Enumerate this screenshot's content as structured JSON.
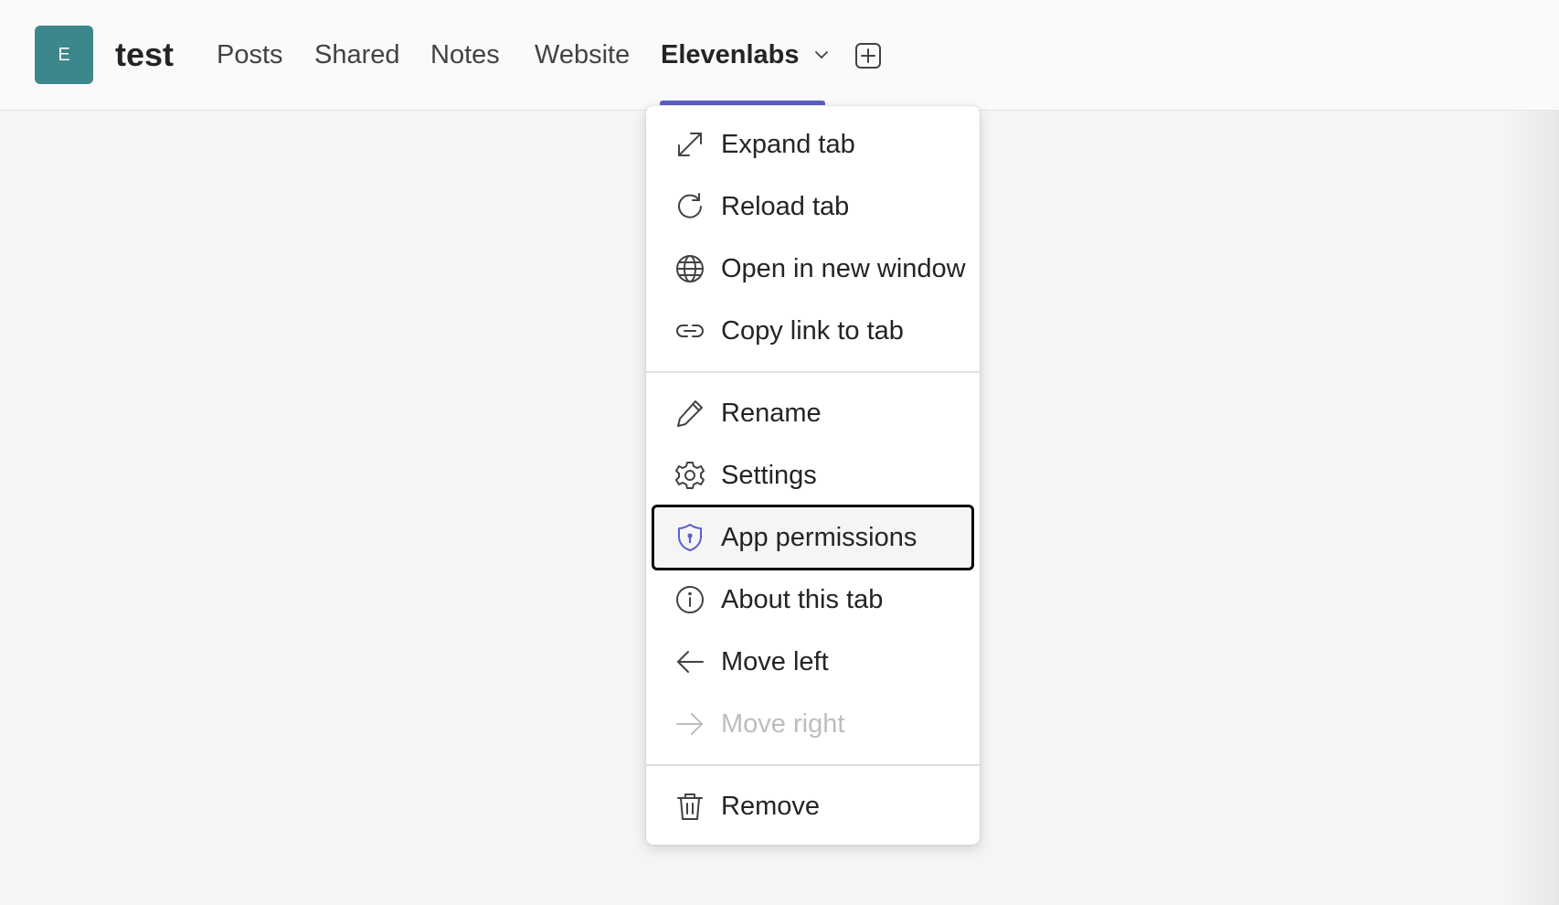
{
  "header": {
    "avatar_letter": "E",
    "avatar_color": "#3c878b",
    "team_name": "test",
    "tabs": [
      {
        "label": "Posts"
      },
      {
        "label": "Shared"
      },
      {
        "label": "Notes"
      },
      {
        "label": "Website"
      },
      {
        "label": "Elevenlabs",
        "active": true
      }
    ],
    "active_tab_icon": "chevron-down-icon",
    "add_tab_icon": "add-tab-icon",
    "accent_color": "#5b5fc7"
  },
  "context_menu": {
    "groups": [
      [
        {
          "label": "Expand tab",
          "icon": "expand-icon"
        },
        {
          "label": "Reload tab",
          "icon": "reload-icon"
        },
        {
          "label": "Open in new window",
          "icon": "globe-icon"
        },
        {
          "label": "Copy link to tab",
          "icon": "link-icon"
        }
      ],
      [
        {
          "label": "Rename",
          "icon": "pencil-icon"
        },
        {
          "label": "Settings",
          "icon": "gear-icon"
        },
        {
          "label": "App permissions",
          "icon": "shield-icon",
          "focused": true
        },
        {
          "label": "About this tab",
          "icon": "info-icon"
        },
        {
          "label": "Move left",
          "icon": "arrow-left-icon"
        },
        {
          "label": "Move right",
          "icon": "arrow-right-icon",
          "disabled": true
        }
      ],
      [
        {
          "label": "Remove",
          "icon": "trash-icon"
        }
      ]
    ]
  }
}
